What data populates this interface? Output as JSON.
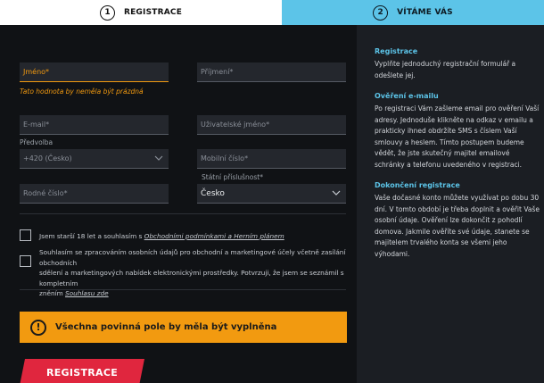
{
  "steps": [
    {
      "num": "1",
      "label": "REGISTRACE"
    },
    {
      "num": "2",
      "label": "VÍTÁME VÁS"
    }
  ],
  "form": {
    "first_name": {
      "placeholder": "Jméno*",
      "error": "Tato hodnota by neměla být prázdná"
    },
    "last_name": {
      "placeholder": "Příjmení*"
    },
    "email": {
      "placeholder": "E-mail*"
    },
    "username": {
      "placeholder": "Uživatelské jméno*"
    },
    "prefix": {
      "label": "Předvolba",
      "value": "+420 (Česko)"
    },
    "mobile": {
      "placeholder": "Mobilní číslo*"
    },
    "birth_number": {
      "placeholder": "Rodné číslo*"
    },
    "citizenship": {
      "label": "Státní příslušnost*",
      "value": "Česko"
    },
    "terms": {
      "text": "Jsem starší 18 let a souhlasím s",
      "link": "Obchodními podmínkami a Herním plánem"
    },
    "consent": {
      "line1": "Souhlasím se zpracováním osobních údajů pro obchodní a marketingové účely včetně zasílání obchodních",
      "line2": "sdělení a marketingových nabídek elektronickými prostředky. Potvrzuji, že jsem se seznámil s kompletním",
      "line3": "zněním",
      "link": "Souhlasu zde"
    },
    "alert": {
      "icon": "!",
      "text": "Všechna povinná pole by měla být vyplněna"
    },
    "submit": "REGISTRACE"
  },
  "side": {
    "s1": {
      "title": "Registrace",
      "text": "Vyplňte jednoduchý registrační formulář a odešlete jej."
    },
    "s2": {
      "title": "Ověření e-mailu",
      "text": "Po registraci Vám zašleme email pro ověření Vaší adresy. Jednoduše klikněte na odkaz v emailu a prakticky ihned obdržíte SMS s číslem Vaší smlouvy a heslem. Tímto postupem budeme vědět, že jste skutečný majitel emailové schránky a telefonu uvedeného v registraci."
    },
    "s3": {
      "title": "Dokončení registrace",
      "text": "Vaše dočasné konto můžete využívat po dobu 30 dní. V tomto období je třeba doplnit a ověřit Vaše osobní údaje. Ověření lze dokončit z pohodlí domova. Jakmile ověříte své údaje, stanete se majitelem trvalého konta se všemi jeho výhodami."
    }
  },
  "colors": {
    "accent": "#5cc4e8",
    "warning": "#f29a10",
    "brand_red": "#e0263e"
  }
}
